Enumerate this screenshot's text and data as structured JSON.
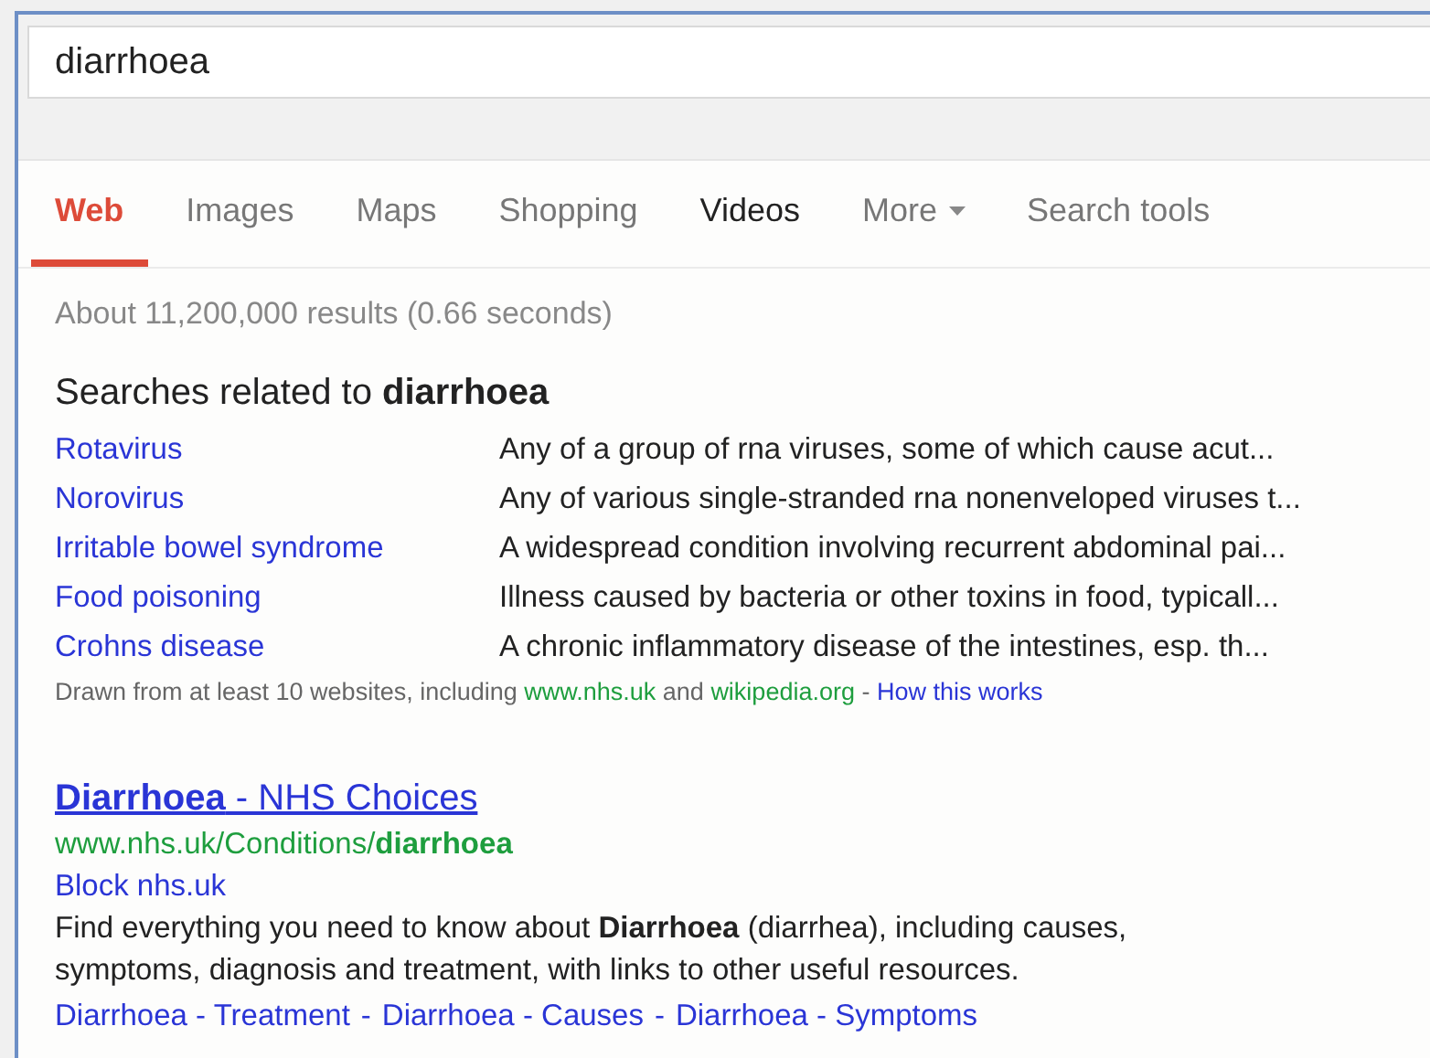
{
  "search": {
    "value": "diarrhoea"
  },
  "tabs": [
    {
      "label": "Web",
      "selected": true,
      "hovered": false,
      "dropdown": false
    },
    {
      "label": "Images",
      "selected": false,
      "hovered": false,
      "dropdown": false
    },
    {
      "label": "Maps",
      "selected": false,
      "hovered": false,
      "dropdown": false
    },
    {
      "label": "Shopping",
      "selected": false,
      "hovered": false,
      "dropdown": false
    },
    {
      "label": "Videos",
      "selected": false,
      "hovered": true,
      "dropdown": false
    },
    {
      "label": "More",
      "selected": false,
      "hovered": false,
      "dropdown": true
    },
    {
      "label": "Search tools",
      "selected": false,
      "hovered": false,
      "dropdown": false
    }
  ],
  "result_stats": "About 11,200,000 results (0.66 seconds)",
  "related": {
    "heading": "Searches related to **diarrhoea**",
    "items": [
      {
        "term": "Rotavirus",
        "description": "Any of a group of rna viruses, some of which cause acut..."
      },
      {
        "term": "Norovirus",
        "description": "Any of various single-stranded rna nonenveloped viruses t..."
      },
      {
        "term": "Irritable bowel syndrome",
        "description": "A widespread condition involving recurrent abdominal pai..."
      },
      {
        "term": "Food poisoning",
        "description": "Illness caused by bacteria or other toxins in food, typicall..."
      },
      {
        "term": "Crohns disease",
        "description": "A chronic inflammatory disease of the intestines, esp. th..."
      }
    ],
    "source_note": {
      "prefix": "Drawn from at least 10 websites, including",
      "source_1": "www.nhs.uk",
      "joiner": "and",
      "source_2": "wikipedia.org",
      "separator": "-",
      "link": "How this works"
    }
  },
  "result": {
    "title": "**Diarrhoea** - NHS Choices",
    "url": "www.nhs.uk/Conditions/**diarrhoea**",
    "block_link": "Block nhs.uk",
    "snippet": "Find everything you need to know about **Diarrhoea** (diarrhea), including causes, symptoms, diagnosis and treatment, with links to other useful resources.",
    "sitelinks": [
      "Diarrhoea - Treatment",
      "Diarrhoea - Causes",
      "Diarrhoea - Symptoms"
    ],
    "sitelink_separator": "-"
  }
}
